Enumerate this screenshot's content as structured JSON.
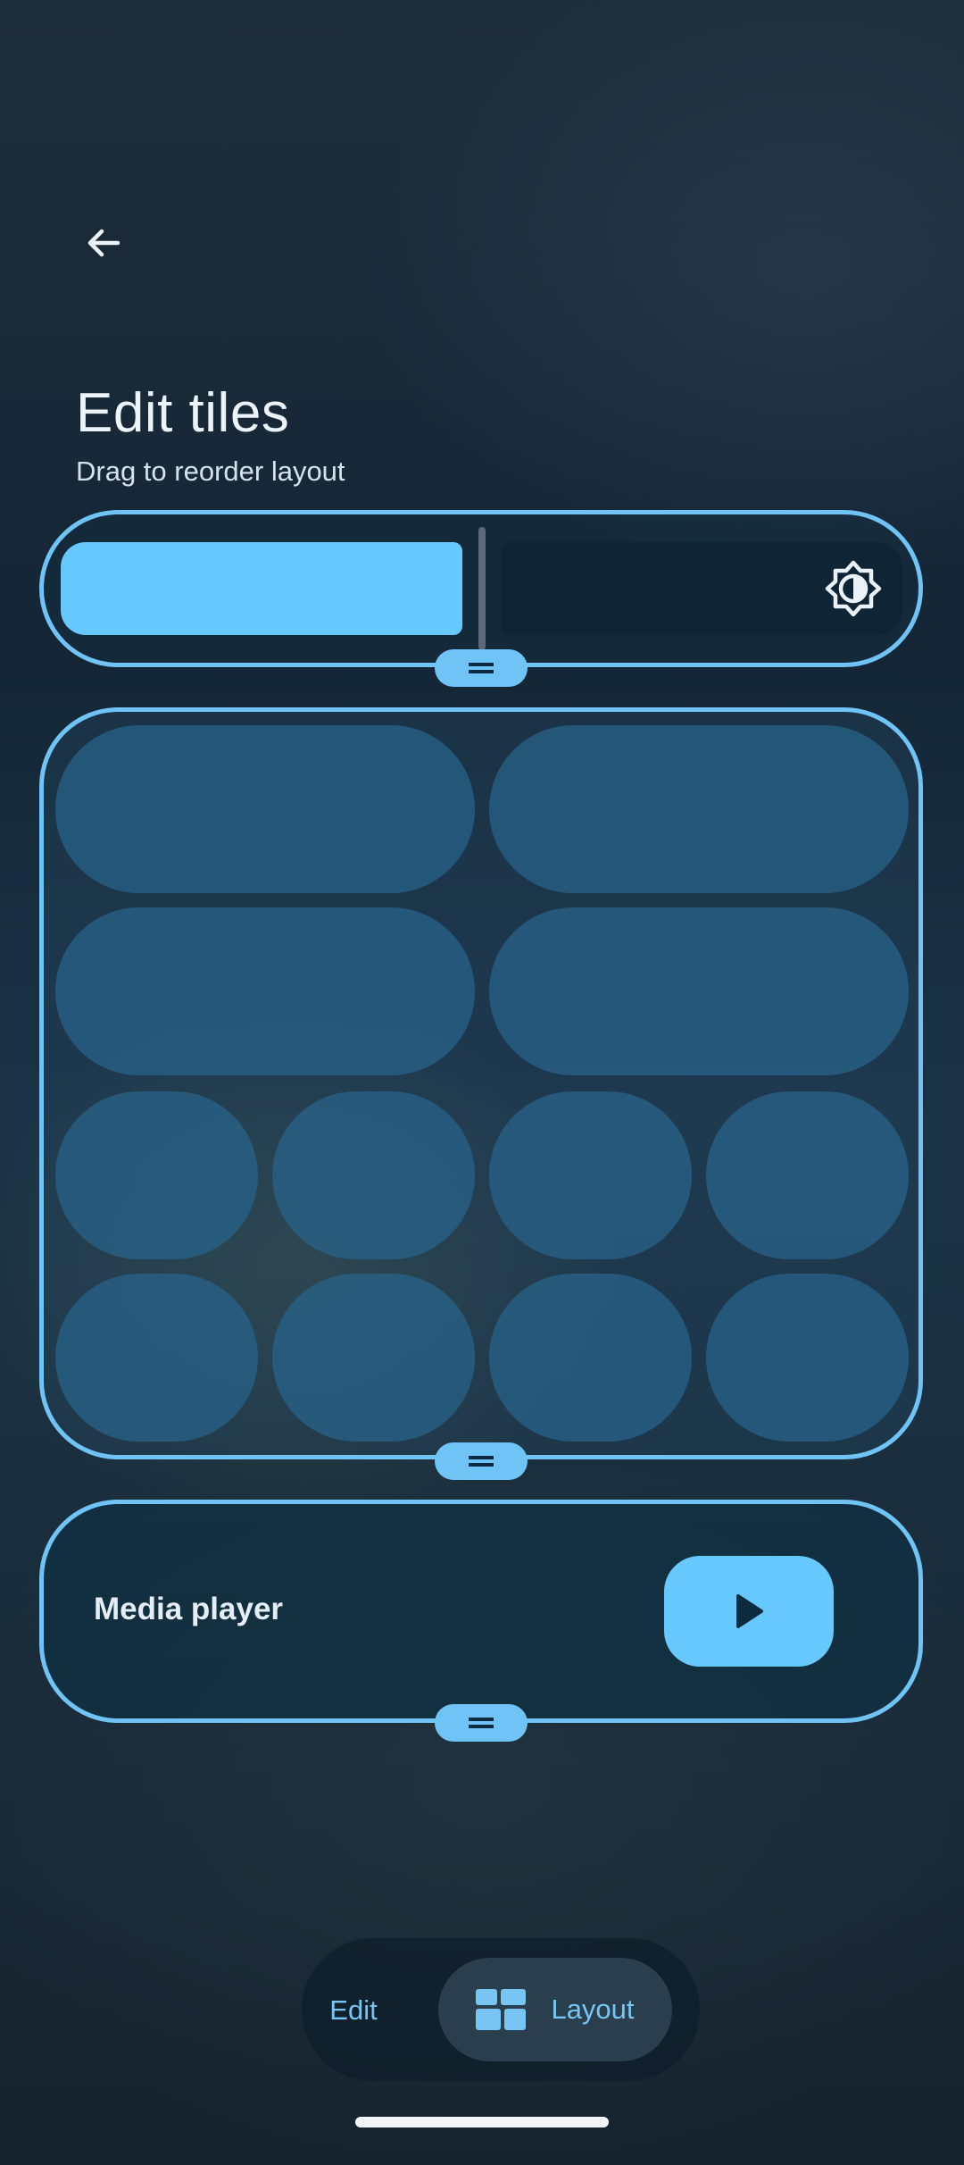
{
  "header": {
    "back_icon": "arrow-left-icon",
    "title": "Edit tiles",
    "subtitle": "Drag to reorder layout"
  },
  "brightness_section": {
    "slider_level_percent": 48,
    "icon": "brightness-icon"
  },
  "tiles_section": {
    "large_tile_count": 4,
    "small_tile_count": 8
  },
  "media_section": {
    "label": "Media player",
    "play_icon": "play-icon"
  },
  "bottom_nav": {
    "edit_label": "Edit",
    "layout_label": "Layout",
    "layout_icon": "layout-grid-icon",
    "selected": "Layout"
  },
  "colors": {
    "accent": "#66c8fd",
    "outline": "#6fc4f5",
    "tile": "#28648c",
    "handle_icon": "#0b2b3e"
  }
}
